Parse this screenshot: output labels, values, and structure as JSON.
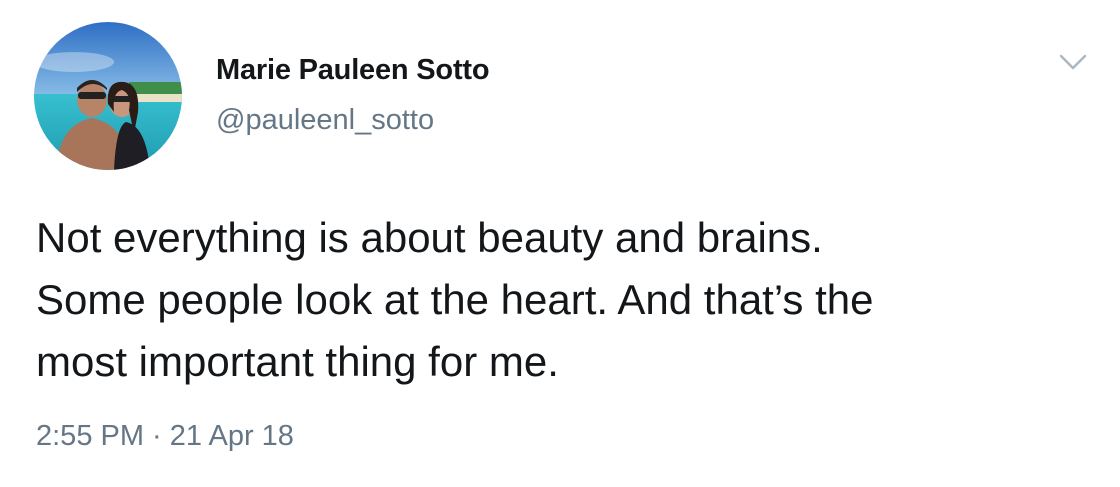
{
  "tweet": {
    "author": {
      "display_name": "Marie Pauleen Sotto",
      "handle": "@pauleenl_sotto",
      "avatar_icon": "profile-photo"
    },
    "text": "Not everything is about beauty and brains.\nSome people look at the heart. And that’s the\nmost important thing for me.",
    "timestamp": "2:55 PM · 21 Apr 18",
    "menu_icon": "chevron-down-icon"
  },
  "colors": {
    "primary_text": "#14171a",
    "secondary_text": "#657786",
    "background": "#ffffff",
    "chevron": "#aab8c2"
  }
}
